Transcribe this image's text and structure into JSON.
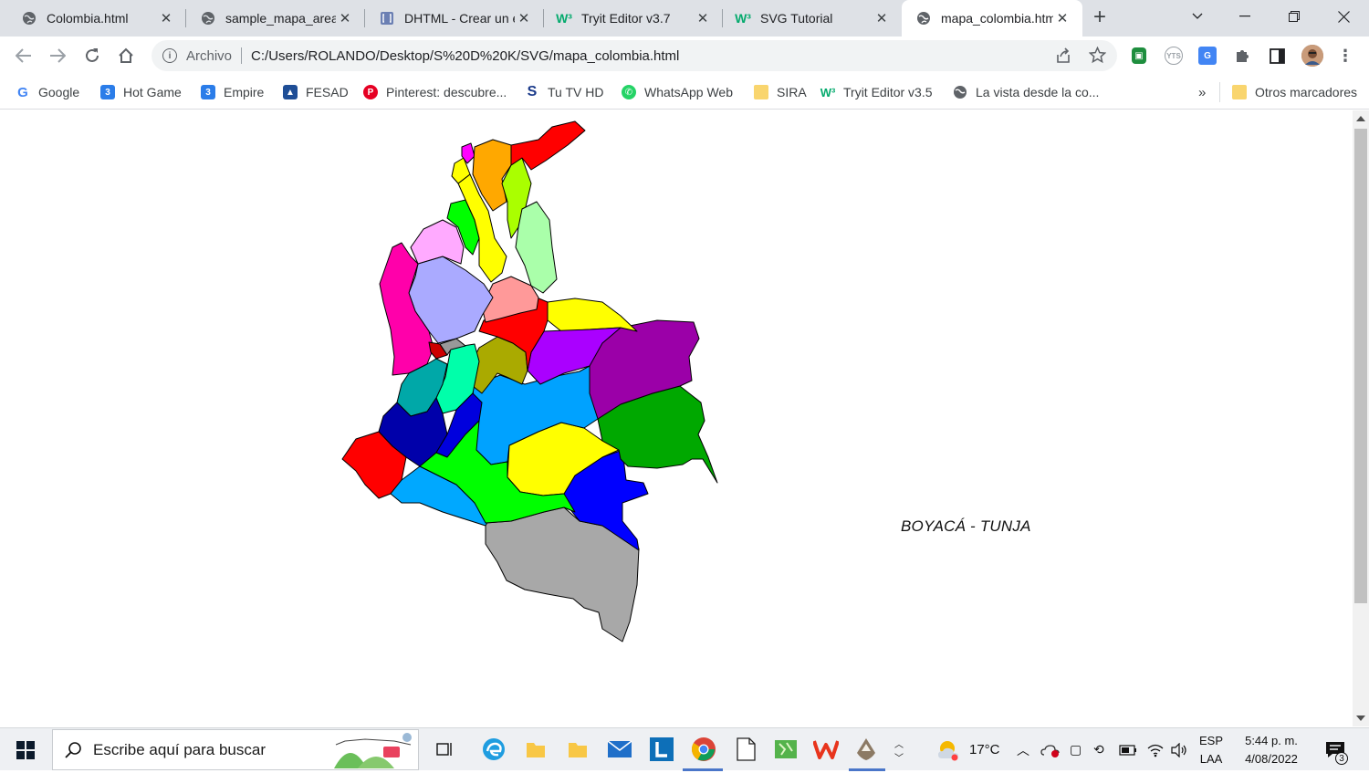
{
  "tabs": [
    {
      "title": "Colombia.html",
      "icon": "globe-icon",
      "active": false
    },
    {
      "title": "sample_mapa_areas",
      "icon": "globe-icon",
      "active": false
    },
    {
      "title": "DHTML - Crear un e",
      "icon": "bracket-icon",
      "active": false
    },
    {
      "title": "Tryit Editor v3.7",
      "icon": "w3schools-icon",
      "active": false
    },
    {
      "title": "SVG Tutorial",
      "icon": "w3schools-icon",
      "active": false
    },
    {
      "title": "mapa_colombia.htm",
      "icon": "globe-icon",
      "active": true
    }
  ],
  "address": {
    "scheme": "Archivo",
    "url": "C:/Users/ROLANDO/Desktop/S%20D%20K/SVG/mapa_colombia.html"
  },
  "bookmarks": [
    {
      "label": "Google",
      "icon": "google-icon"
    },
    {
      "label": "Hot Game",
      "icon": "three-icon"
    },
    {
      "label": "Empire",
      "icon": "three-icon"
    },
    {
      "label": "FESAD",
      "icon": "fesad-icon"
    },
    {
      "label": "Pinterest: descubre...",
      "icon": "pinterest-icon"
    },
    {
      "label": "Tu TV HD",
      "icon": "s-icon"
    },
    {
      "label": "WhatsApp Web",
      "icon": "whatsapp-icon"
    },
    {
      "label": "SIRA",
      "icon": "folder-icon"
    },
    {
      "label": "Tryit Editor v3.5",
      "icon": "w3schools-icon"
    },
    {
      "label": "La vista desde la co...",
      "icon": "globe-icon"
    }
  ],
  "bookmarks_overflow": "»",
  "other_bookmarks": "Otros marcadores",
  "page": {
    "selected_department": "BOYACÁ - TUNJA"
  },
  "taskbar": {
    "search_placeholder": "Escribe aquí para buscar",
    "weather": "17°C",
    "lang_top": "ESP",
    "lang_bottom": "LAA",
    "time": "5:44 p. m.",
    "date": "4/08/2022",
    "notifications": "3"
  }
}
